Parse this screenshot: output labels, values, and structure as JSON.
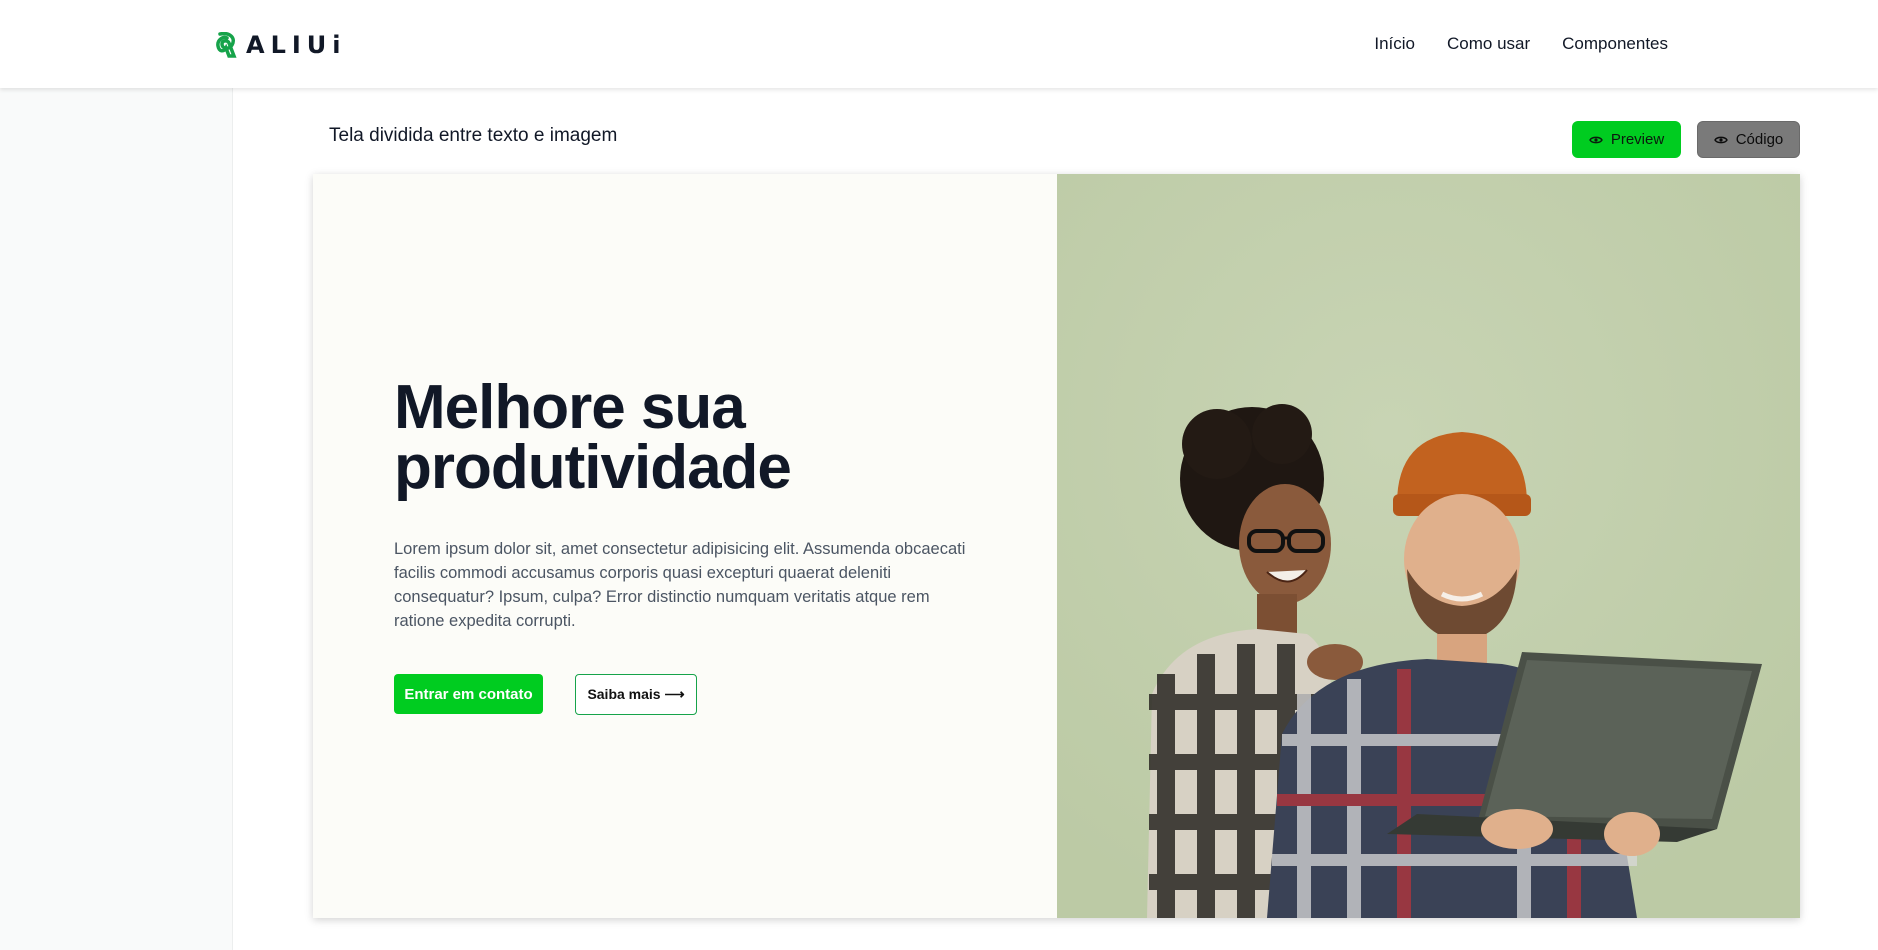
{
  "header": {
    "logo_text": "ALIUi",
    "nav": [
      "Início",
      "Como usar",
      "Componentes"
    ]
  },
  "section": {
    "title": "Tela dividida entre texto e imagem",
    "preview_label": "Preview",
    "code_label": "Código"
  },
  "hero": {
    "title": "Melhore sua produtividade",
    "text": "Lorem ipsum dolor sit, amet consectetur adipisicing elit. Assumenda obcaecati facilis commodi accusamus corporis quasi excepturi quaerat deleniti consequatur? Ipsum, culpa? Error distinctio numquam veritatis atque rem ratione expedita corrupti.",
    "primary_button": "Entrar em contato",
    "secondary_button": "Saiba mais ⟶"
  },
  "colors": {
    "accent": "#00cc20",
    "image_bg": "#c3d0ad",
    "heading": "#111827"
  },
  "icons": {
    "logo": "aliui-logo-icon",
    "preview": "eye-icon",
    "code": "eye-icon"
  }
}
